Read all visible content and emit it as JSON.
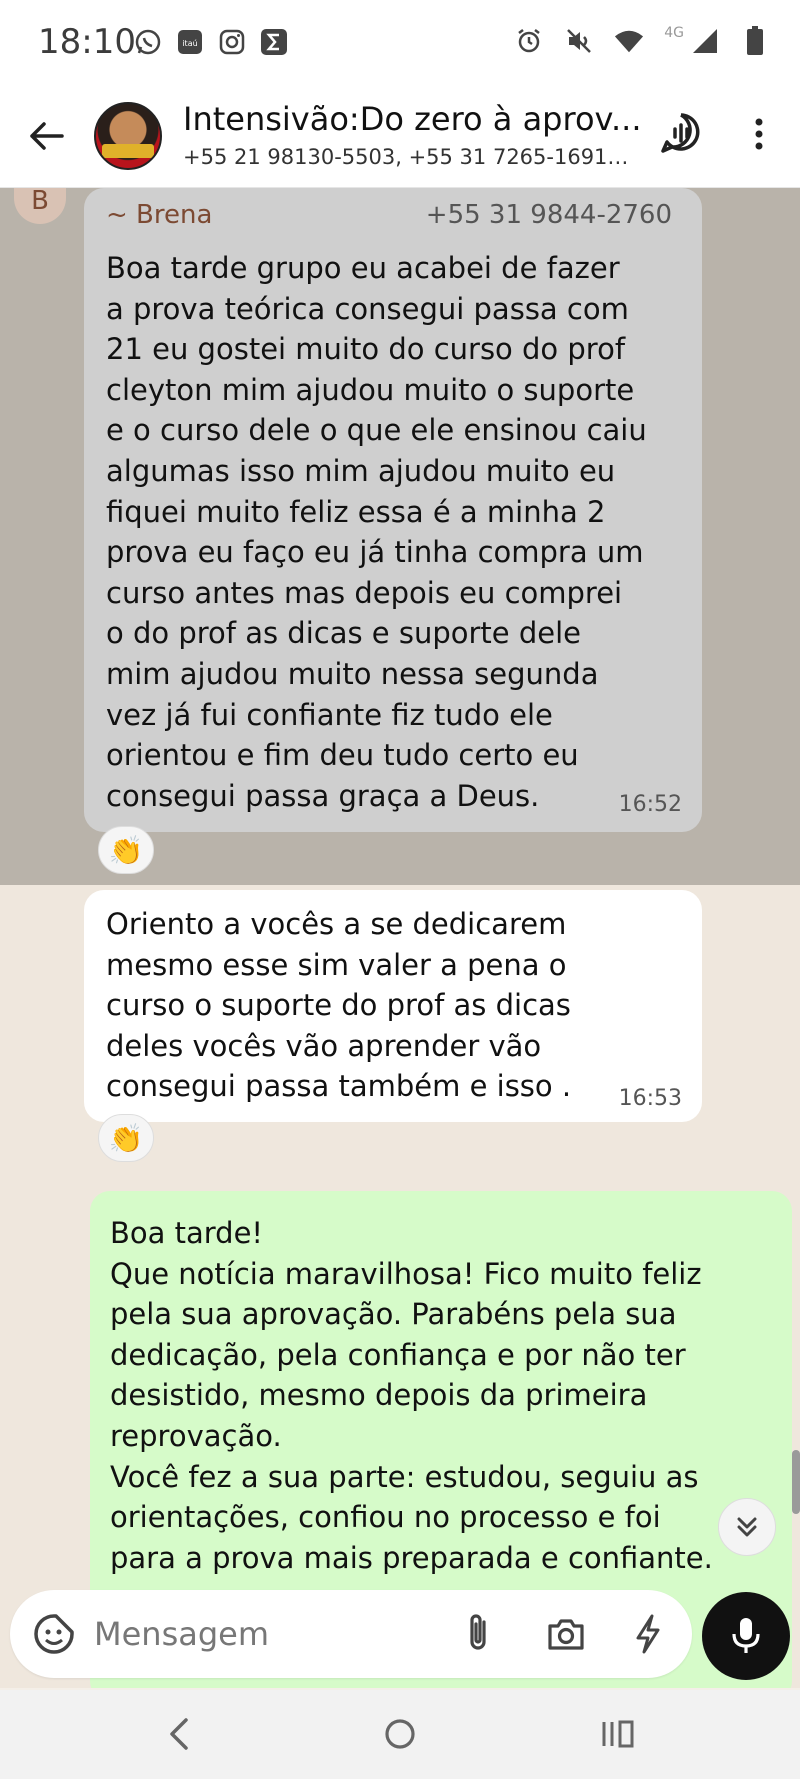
{
  "status_bar": {
    "time": "18:10",
    "left_icons": [
      "whatsapp-icon",
      "itau-icon",
      "instagram-icon",
      "sigma-icon"
    ],
    "right_icons": [
      "alarm-icon",
      "mute-icon",
      "wifi-icon",
      "signal-icon",
      "battery-icon"
    ],
    "network": "4G"
  },
  "header": {
    "title": "Intensivão:Do zero à aprov...",
    "subtitle": "+55 21 98130-5503, +55 31 7265-1691, +5..."
  },
  "messages": [
    {
      "direction": "incoming",
      "sender_initial": "B",
      "sender_name": "~ Brena",
      "sender_phone": "+55 31 9844-2760",
      "text": "Boa tarde grupo eu acabei de fazer\na prova teórica consegui passa com\n21 eu gostei muito do curso do prof\ncleyton mim ajudou muito o suporte\ne o curso dele o que ele ensinou caiu\nalgumas isso mim ajudou muito eu\nfiquei muito feliz essa é a minha 2\nprova eu faço eu já tinha compra um\ncurso antes mas depois eu comprei\no do prof as dicas e suporte dele\nmim ajudou muito nessa segunda\nvez já fui confiante fiz tudo ele\norientou e fim deu tudo certo eu\nconsegui passa graça a Deus.",
      "time": "16:52",
      "reaction": "👏"
    },
    {
      "direction": "incoming",
      "text": "Oriento a vocês a se dedicarem\nmesmo esse sim valer a pena o\ncurso o suporte do prof as dicas\ndeles vocês vão aprender vão\nconsegui passa também e isso .",
      "time": "16:53",
      "reaction": "👏"
    },
    {
      "direction": "outgoing",
      "text": "Boa tarde!\nQue notícia maravilhosa! Fico muito feliz\npela sua aprovação. Parabéns pela sua\ndedicação, pela confiança e por não ter\ndesistido, mesmo depois da primeira\nreprovação.\nVocê fez a sua parte: estudou, seguiu as\norientações, confiou no processo e foi\npara a prova mais preparada e confiante."
    }
  ],
  "input": {
    "placeholder": "Mensagem"
  },
  "colors": {
    "incoming_bubble": "#ffffff",
    "selected_bubble": "#cfcfcf",
    "outgoing_bubble": "#d6fbc9",
    "sender_name": "#7c4a33",
    "mic_button": "#111111"
  }
}
